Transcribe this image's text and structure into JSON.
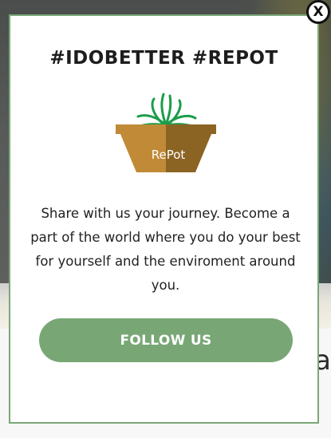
{
  "modal": {
    "title": "#IDOBETTER #REPOT",
    "logo_text": "RePot",
    "body": "Share with us your journey. Become a part of the world where you do your best for yourself and the enviroment around you.",
    "follow_label": "FOLLOW US",
    "close_label": "X",
    "icons": {
      "close": "close-icon",
      "logo": "plant-pot-logo"
    }
  },
  "background": {
    "fragment_text": "a"
  },
  "colors": {
    "accent_green": "#78a775",
    "modal_border": "#7aa878",
    "pot_light": "#c08a36",
    "pot_dark": "#8b6424",
    "plant_green": "#1b9d4a"
  }
}
